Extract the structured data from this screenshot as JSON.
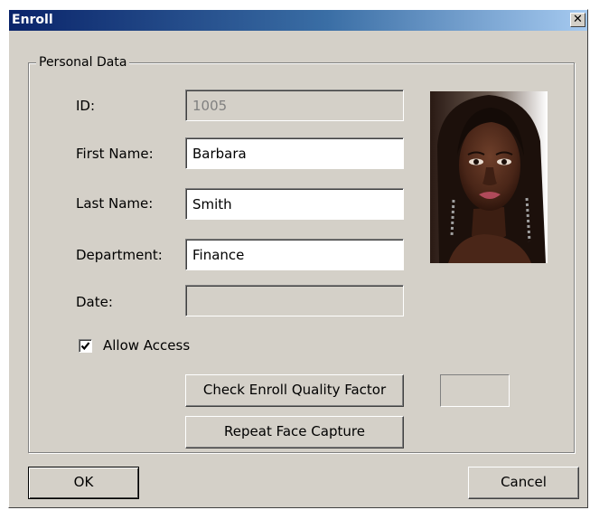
{
  "window": {
    "title": "Enroll",
    "close_glyph": "✕",
    "close_icon": "close-icon"
  },
  "group": {
    "legend": "Personal Data"
  },
  "fields": {
    "id": {
      "label": "ID:",
      "value": "1005",
      "disabled": true
    },
    "first_name": {
      "label": "First Name:",
      "value": "Barbara"
    },
    "last_name": {
      "label": "Last Name:",
      "value": "Smith"
    },
    "department": {
      "label": "Department:",
      "value": "Finance"
    },
    "date": {
      "label": "Date:",
      "value": "",
      "disabled": true
    }
  },
  "allow_access": {
    "label": "Allow Access",
    "checked": true
  },
  "buttons": {
    "check_quality": "Check Enroll Quality Factor",
    "repeat_capture": "Repeat Face Capture",
    "ok": "OK",
    "cancel": "Cancel"
  },
  "quality_factor": {
    "value": ""
  },
  "colors": {
    "dialog_bg": "#d4d0c8",
    "title_gradient_start": "#0a246a",
    "title_gradient_end": "#a6caf0",
    "disabled_text": "#808080"
  }
}
